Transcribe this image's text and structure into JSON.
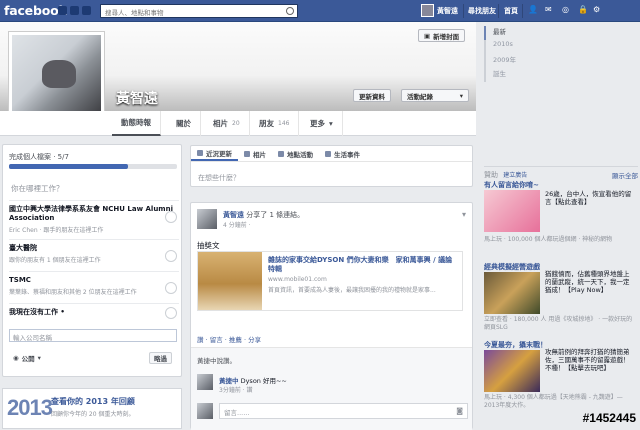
{
  "topbar": {
    "logo": "facebook",
    "search_placeholder": "搜尋人、地點和事物",
    "user_name": "黃智遠",
    "find_friends": "尋找朋友",
    "home": "首頁"
  },
  "profile": {
    "name": "黃智遠",
    "add_cover_label": "新增封面",
    "update_info_label": "更新資料",
    "activity_log_label": "活動紀錄"
  },
  "tabs": [
    {
      "label": "動態時報",
      "count": ""
    },
    {
      "label": "關於",
      "count": ""
    },
    {
      "label": "相片",
      "count": "20"
    },
    {
      "label": "朋友",
      "count": "146"
    },
    {
      "label": "更多",
      "count": ""
    }
  ],
  "timeline_nav": [
    "最新",
    "2010s",
    "2009年",
    "誕生"
  ],
  "profile_completion": {
    "title": "完成個人檔案 · 5/7",
    "progress": 0.71,
    "question": "你在哪裡工作？",
    "jobs": [
      {
        "title": "國立中興大學法律學系系友會 NCHU Law Alumni Association",
        "detail": "Eric Chen · 跟手的朋友在這裡工作"
      },
      {
        "title": "臺大醫院",
        "detail": "跟你的朋友有 1 個朋友在這裡工作"
      },
      {
        "title": "TSMC",
        "detail": "葉葉錄、蔡福和朋友和其他 2 位朋友在這裡工作"
      },
      {
        "title": "我現在沒有工作 •",
        "detail": ""
      }
    ],
    "company_placeholder": "輸入公司名稱",
    "privacy_label": "公開",
    "skip_label": "略過"
  },
  "year_review": {
    "year": "2013",
    "heading": "查看你的 2013 年回顧",
    "sub": "回顧你今年的 20 個重大時刻。"
  },
  "composer": {
    "tabs": [
      "近況更新",
      "相片",
      "地點活動",
      "生活事件"
    ],
    "placeholder": "在想些什麼？"
  },
  "post": {
    "author": "黃智遠",
    "action": "分享了 1 條連結。",
    "time": "4 分鐘前 ·",
    "text": "抽獎文",
    "link": {
      "title": "雜誌的家事交給DYSON 們你大妻和樂　家和萬事興 / 議論特輯",
      "url": "www.mobile01.com",
      "desc": "首頁資訊，首要成為人妻後，最讓我困擾的我的禮物就是家事..."
    },
    "actions": "讚 · 留言 · 推薦 · 分享",
    "like_summary": "黃捷中說讚。",
    "comment": {
      "author": "黃捷中",
      "text": "Dyson 好用~~",
      "meta": "3分鐘前 · 讚"
    },
    "comment_placeholder": "留言......"
  },
  "sidebar": {
    "sponsored": "贊助",
    "create_ad": "建立廣告",
    "show_all": "顯示全部",
    "ads": [
      {
        "title": "有人留言給你唷~",
        "text": "26歲，台中人，恢宣看他的留言【點此查看】",
        "like": "馬上玩 · 100,000 個人都玩過個網 · 神秘的網物"
      },
      {
        "title": "經典模擬經營遊戲",
        "text": "猶餓憤而，佔舊種頭界地盤上的蘭武蹤，統一天下，我一定猶成！【Play Now】",
        "like": "立即查看 · 180,000 人 用過《攻城掠地》 · 一款好玩的網頁SLG"
      },
      {
        "title": "今夏最夯，攝末戰！",
        "text": "攻無前例的拜奔打猶的猜簡弟佐，三國萬事不的留露遊戲！不種！【點擊去玩吧】",
        "like": "馬上玩 · 4,300 個人都玩過【天地熊霸 - 九魏遊】—2013年度大作。"
      }
    ]
  },
  "watermark": "#1452445"
}
